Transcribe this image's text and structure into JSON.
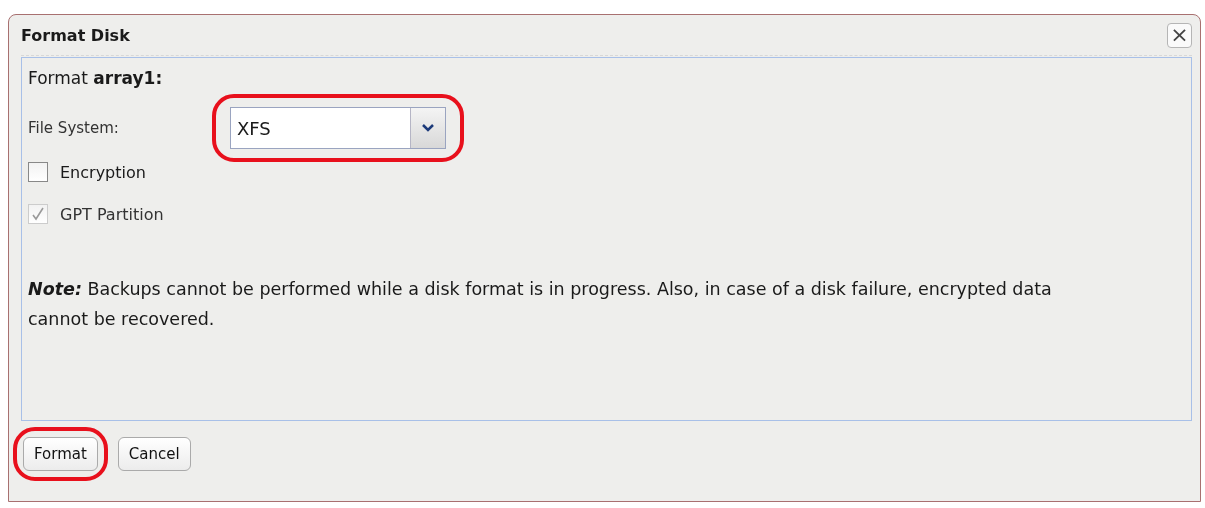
{
  "dialog": {
    "title": "Format Disk",
    "close": "×"
  },
  "heading": "Format **array1:**",
  "file_system": {
    "label": "File System:",
    "value": "XFS",
    "highlighted": true
  },
  "options": [
    {
      "label": "Encryption",
      "checked": false,
      "disabled": false
    },
    {
      "label": "GPT Partition",
      "checked": true,
      "disabled": true
    }
  ],
  "note": "*Note:* Backups cannot be performed while a disk format is in progress. Also, in case of a disk failure, encrypted data cannot be recovered.",
  "buttons": [
    {
      "label": "Format",
      "highlighted": true
    },
    {
      "label": "Cancel",
      "highlighted": false
    }
  ]
}
